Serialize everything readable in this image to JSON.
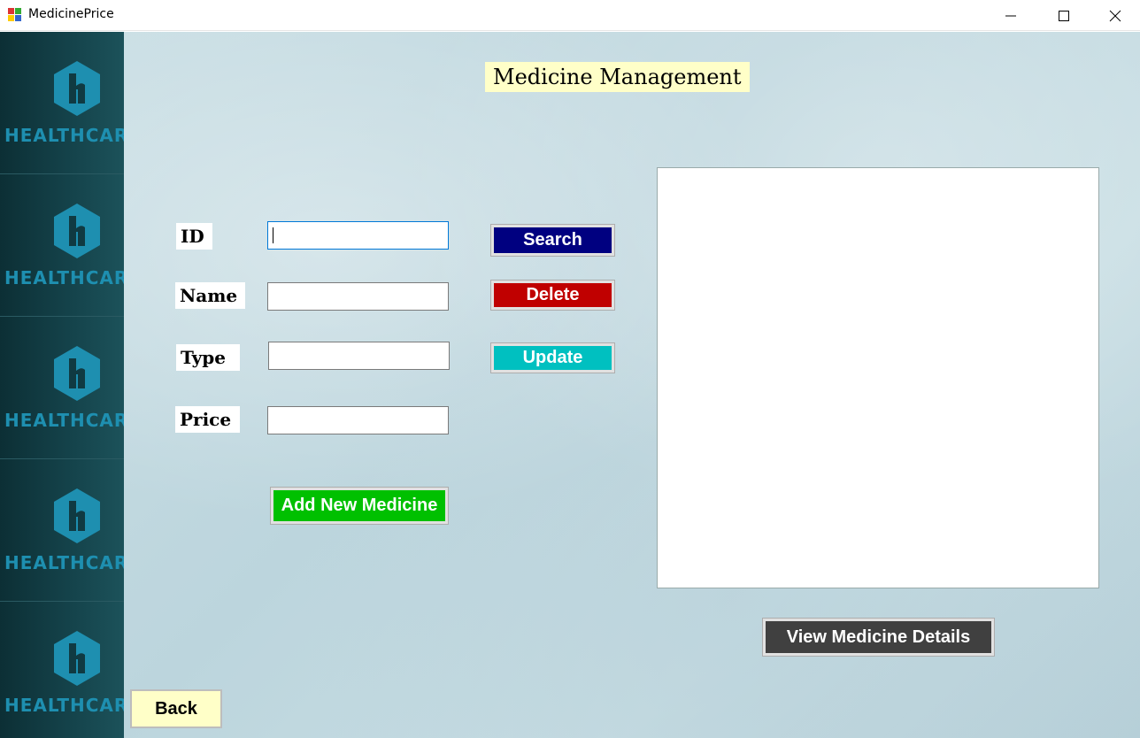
{
  "window": {
    "title": "MedicinePrice",
    "controls": [
      "minimize-icon",
      "maximize-icon",
      "close-icon"
    ]
  },
  "sidebar": {
    "brand_text": "HEALTHCARE",
    "repeat_count": 5,
    "brand_color": "#1e8fb0"
  },
  "main": {
    "heading": "Medicine Management",
    "form": {
      "id_label": "ID",
      "name_label": "Name",
      "type_label": "Type",
      "price_label": "Price",
      "id_value": "",
      "name_value": "",
      "type_value": "",
      "price_value": ""
    },
    "buttons": {
      "search": "Search",
      "delete": "Delete",
      "update": "Update",
      "add_new": "Add New Medicine",
      "view_details": "View Medicine Details",
      "back": "Back"
    },
    "colors": {
      "search": "#000080",
      "delete": "#c00000",
      "update": "#00c0c0",
      "add_new": "#00c000",
      "view_details": "#404040",
      "back": "#ffffc8",
      "heading_bg": "#ffffc8"
    }
  }
}
